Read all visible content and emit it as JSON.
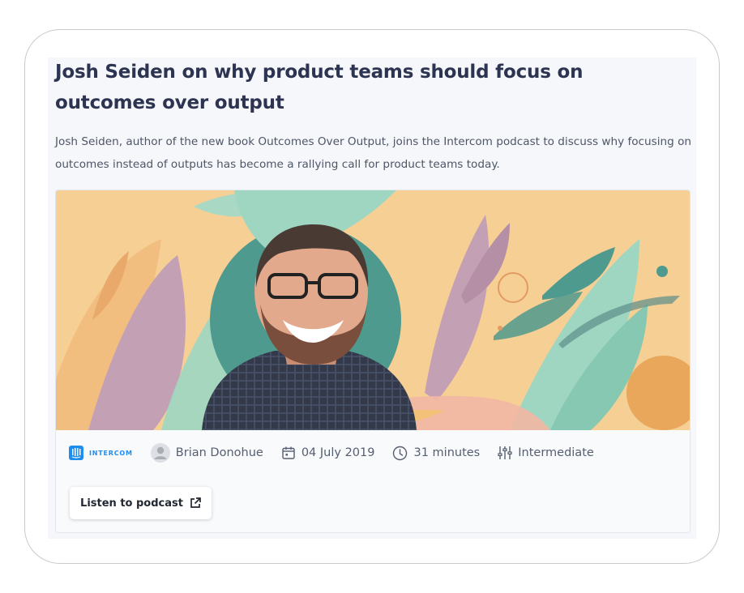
{
  "article": {
    "title": "Josh Seiden on why product teams should focus on outcomes over output",
    "description": "Josh Seiden, author of the new book Outcomes Over Output, joins the Intercom podcast to discuss why focusing on outcomes instead of outputs has become a rallying call for product teams today."
  },
  "meta": {
    "brand": "INTERCOM",
    "brand_icon": "intercom-logo-icon",
    "author": "Brian Donohue",
    "author_icon": "user-avatar-icon",
    "date": "04 July 2019",
    "date_icon": "calendar-icon",
    "duration": "31 minutes",
    "duration_icon": "clock-icon",
    "level": "Intermediate",
    "level_icon": "sliders-icon"
  },
  "actions": {
    "listen_label": "Listen to podcast",
    "listen_icon": "external-link-icon"
  },
  "colors": {
    "title": "#2d3452",
    "brand": "#1f8ded",
    "background_peach": "#f6cf95",
    "mint": "#9fd6c2",
    "teal": "#4f9a8e",
    "mauve": "#c4a0b5"
  }
}
